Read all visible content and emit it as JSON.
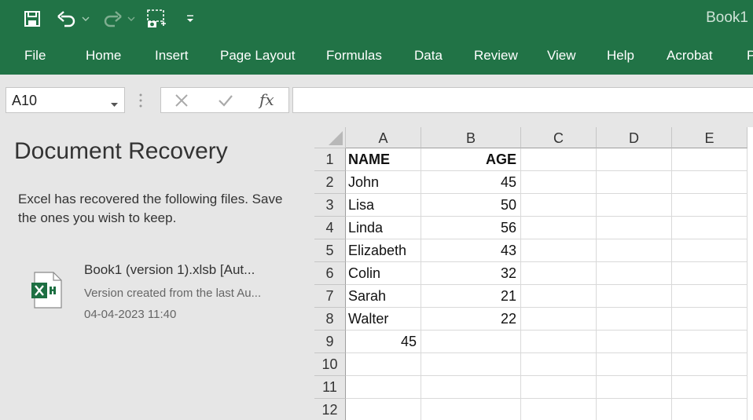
{
  "window": {
    "title": "Book1"
  },
  "qat": {
    "save": "save-icon",
    "undo": "undo-icon",
    "redo": "redo-icon",
    "screenshot": "screenshot-icon",
    "customize": "customize-icon"
  },
  "ribbon": {
    "tabs": [
      {
        "label": "File"
      },
      {
        "label": "Home"
      },
      {
        "label": "Insert"
      },
      {
        "label": "Page Layout"
      },
      {
        "label": "Formulas"
      },
      {
        "label": "Data"
      },
      {
        "label": "Review"
      },
      {
        "label": "View"
      },
      {
        "label": "Help"
      },
      {
        "label": "Acrobat"
      },
      {
        "label": "P"
      }
    ]
  },
  "formula_bar": {
    "name_box": "A10",
    "formula": "",
    "fx_label": "fx"
  },
  "recovery": {
    "title": "Document Recovery",
    "description": "Excel has recovered the following files.  Save the ones you wish to keep.",
    "files": [
      {
        "name": "Book1 (version 1).xlsb  [Aut...",
        "subtitle": "Version created from the last Au...",
        "date": "04-04-2023 11:40"
      }
    ]
  },
  "sheet": {
    "columns": [
      "A",
      "B",
      "C",
      "D",
      "E"
    ],
    "rows": [
      "1",
      "2",
      "3",
      "4",
      "5",
      "6",
      "7",
      "8",
      "9",
      "10",
      "11",
      "12"
    ],
    "cells": [
      [
        "NAME",
        "AGE"
      ],
      [
        "John",
        "45"
      ],
      [
        "Lisa",
        "50"
      ],
      [
        "Linda",
        "56"
      ],
      [
        "Elizabeth",
        "43"
      ],
      [
        "Colin",
        "32"
      ],
      [
        "Sarah",
        "21"
      ],
      [
        "Walter",
        "22"
      ],
      [
        "45",
        ""
      ]
    ]
  },
  "colors": {
    "accent": "#217346",
    "pane": "#e6e6e6",
    "grid_line": "#d9d9d9"
  }
}
